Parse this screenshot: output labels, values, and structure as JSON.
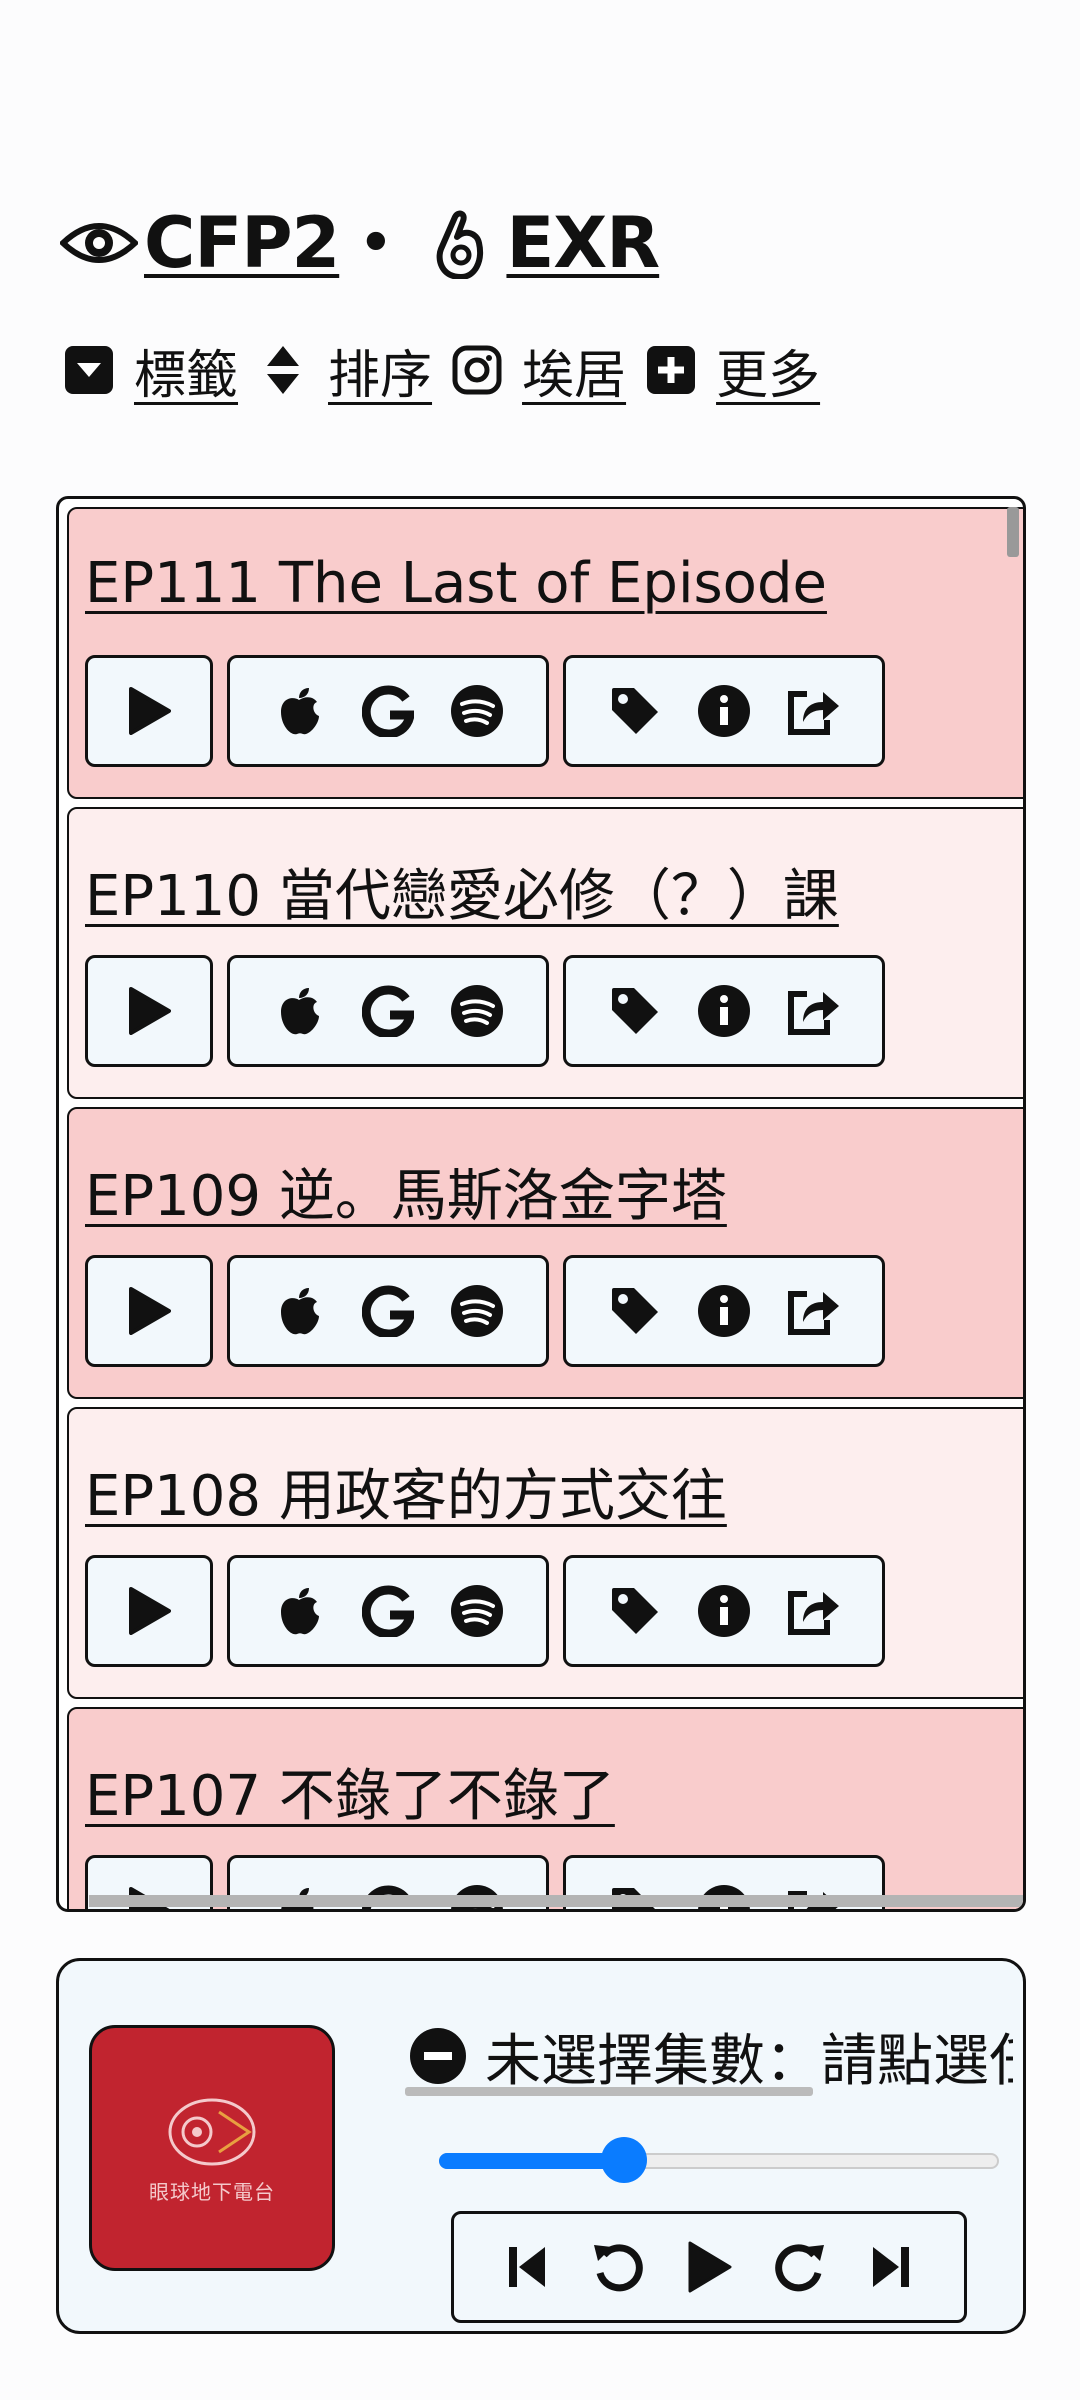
{
  "header": {
    "brand1": "CFP2",
    "brand1_icon": "eye-icon",
    "separator": "•",
    "brand2": "EXR",
    "brand2_icon": "hand-gesture-icon"
  },
  "nav": [
    {
      "label": "標籤",
      "icon": "tag-box-icon"
    },
    {
      "label": "排序",
      "icon": "sort-icon"
    },
    {
      "label": "埃居",
      "icon": "instagram-icon"
    },
    {
      "label": "更多",
      "icon": "plus-box-icon"
    }
  ],
  "episodes": [
    {
      "title": "EP111 The Last of Episode",
      "bg": "#f9cccc"
    },
    {
      "title": "EP110 當代戀愛必修（？）課",
      "bg": "#fdeeee"
    },
    {
      "title": "EP109 逆。馬斯洛金字塔",
      "bg": "#f9cccc"
    },
    {
      "title": "EP108 用政客的方式交往",
      "bg": "#fdeeee"
    },
    {
      "title": "EP107 不錄了不錄了",
      "bg": "#f9cccc"
    }
  ],
  "episode_buttons": {
    "play": "play-icon",
    "platforms": [
      "apple-icon",
      "google-icon",
      "spotify-icon"
    ],
    "actions": [
      "tag-icon",
      "info-icon",
      "share-icon"
    ]
  },
  "player": {
    "cover_label": "眼球地下電台",
    "cover_bg": "#c1242f",
    "now_playing": "未選擇集數：請點選任",
    "now_playing_icon": "minus-circle-icon",
    "progress": 0.33,
    "accent": "#0a7cff",
    "controls": [
      "skip-back-icon",
      "rewind-icon",
      "play-icon",
      "forward-icon",
      "skip-forward-icon"
    ]
  }
}
